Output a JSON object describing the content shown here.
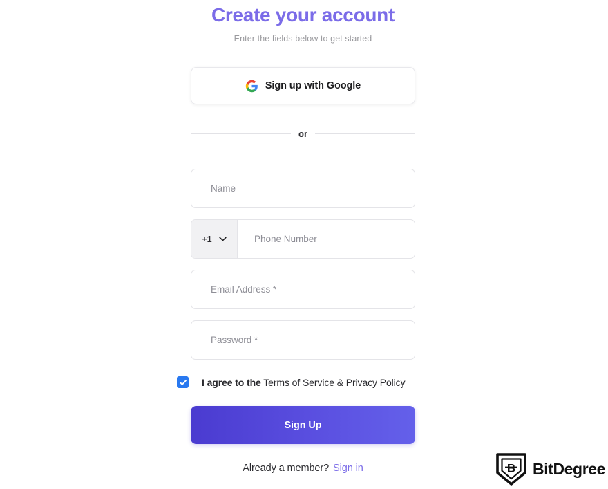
{
  "header": {
    "title": "Create your account",
    "subtitle": "Enter the fields below to get started",
    "title_color": "#7b6ce8"
  },
  "social": {
    "google_label": "Sign up with Google",
    "google_icon": "google-g-icon"
  },
  "divider": {
    "label": "or"
  },
  "form": {
    "fields": [
      {
        "name": "name",
        "placeholder": "Name"
      },
      {
        "name": "phone",
        "placeholder": "Phone Number",
        "country_code": "+1",
        "chevron_icon": "chevron-down-icon"
      },
      {
        "name": "email",
        "placeholder": "Email Address *"
      },
      {
        "name": "password",
        "placeholder": "Password *"
      }
    ],
    "terms": {
      "checked": true,
      "checkbox_color": "#2979f0",
      "check_icon": "checkmark-icon",
      "agree_text": "I agree to the",
      "links_text": "Terms of Service & Privacy Policy"
    },
    "submit_label": "Sign Up",
    "submit_gradient_start": "#4a3bd0",
    "submit_gradient_end": "#6460ea"
  },
  "footer": {
    "prompt": "Already a member?",
    "signin_label": "Sign in",
    "link_color": "#7b6ce8"
  },
  "brand": {
    "shield_icon": "bitdegree-shield-icon",
    "wordmark": "BitDegree"
  }
}
